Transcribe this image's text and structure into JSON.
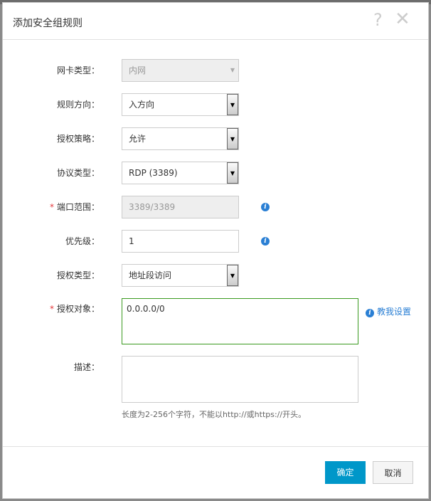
{
  "dialog": {
    "title": "添加安全组规则",
    "help": "?",
    "close": "✕"
  },
  "fields": [
    {
      "label": "网卡类型：",
      "value": "内网",
      "required": false,
      "disabled": true,
      "type": "select"
    },
    {
      "label": "规则方向：",
      "value": "入方向",
      "required": false,
      "disabled": false,
      "type": "select"
    },
    {
      "label": "授权策略：",
      "value": "允许",
      "required": false,
      "disabled": false,
      "type": "select"
    },
    {
      "label": "协议类型：",
      "value": "RDP (3389)",
      "required": false,
      "disabled": false,
      "type": "select"
    },
    {
      "label": "端口范围：",
      "value": "3389/3389",
      "required": true,
      "disabled": true,
      "type": "input"
    },
    {
      "label": "优先级：",
      "value": "1",
      "required": false,
      "disabled": false,
      "type": "input"
    },
    {
      "label": "授权类型：",
      "value": "地址段访问",
      "required": false,
      "disabled": false,
      "type": "select"
    }
  ],
  "auth_object": {
    "label": "授权对象：",
    "value": "0.0.0.0/0",
    "teach": "教我设置"
  },
  "description": {
    "label": "描述：",
    "value": "",
    "hint": "长度为2-256个字符，不能以http://或https://开头。"
  },
  "required_mark": "*",
  "info_icon": "i",
  "arrow": "▼",
  "buttons": {
    "ok": "确定",
    "cancel": "取消"
  }
}
